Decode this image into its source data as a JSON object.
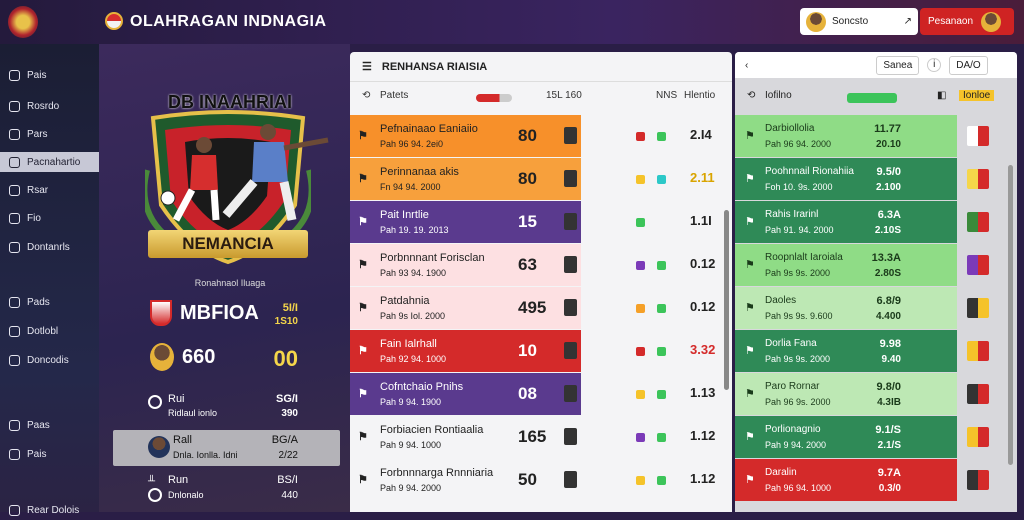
{
  "app": {
    "title": "OLAHRAGAN INDNAGIA",
    "search_text": "Soncsto",
    "cta_label": "Pesanaon"
  },
  "colors": {
    "accent": "#cf2323",
    "gold": "#f5d64a",
    "orange": "#f7902a",
    "purple": "#5a3a8e",
    "red": "#d42a2a",
    "green": "#2f8a57",
    "lightgreen": "#8fdc86"
  },
  "sidebar": {
    "items": [
      {
        "label": "Pais",
        "icon": "ball-icon"
      },
      {
        "label": "Rosrdo",
        "icon": "calendar-icon"
      },
      {
        "label": "Pars",
        "icon": "book-icon"
      },
      {
        "label": "Pacnahartio",
        "icon": "trophy-icon",
        "active": true
      },
      {
        "label": "Rsar",
        "icon": "chat-icon"
      },
      {
        "label": "Fio",
        "icon": "doc-icon"
      },
      {
        "label": "Dontanrls",
        "icon": "home-icon"
      },
      {
        "label": "Pads",
        "icon": "globe-icon"
      },
      {
        "label": "Dotlobl",
        "icon": "list-icon"
      },
      {
        "label": "Doncodis",
        "icon": "shield-icon"
      },
      {
        "label": "Paas",
        "icon": "star-icon"
      },
      {
        "label": "Pais",
        "icon": "users-icon"
      },
      {
        "label": "Rear Dolois",
        "icon": "logout-icon"
      }
    ]
  },
  "hero": {
    "crest_title": "DB INAAHRIAI",
    "banner": "NEMANCIA",
    "subtitle": "Ronahnaol Iluaga",
    "rows": [
      {
        "name": "MBFIOA",
        "val1": "5I/I",
        "val2": "1S10"
      },
      {
        "name": "660",
        "val1": "00",
        "val2": ""
      },
      {
        "name": "Rui",
        "sub": "Ridlaul ionlo",
        "val1": "SG/I",
        "val2": "390"
      }
    ],
    "cards": [
      {
        "name": "Rall",
        "sub": "Dnla. Ionlla. Idni",
        "val1": "BG/A",
        "val2": "2/22"
      },
      {
        "name": "Run",
        "sub": "Dnlonalo",
        "val1": "BS/I",
        "val2": "440"
      }
    ]
  },
  "standings": {
    "title": "RENHANSA RIAISIA",
    "columns": {
      "c1": "Patets",
      "c2": "15L 160",
      "c3": "NNS",
      "c4": "Hlentio"
    },
    "rows": [
      {
        "title": "Pefnainaao Eaniaiio",
        "sub": "Pah 96 94. 2ei0",
        "num": "80",
        "val": "2.I4",
        "bg": "#f7902a",
        "dots": [
          "#d42a2a",
          "#3cc45a"
        ]
      },
      {
        "title": "Perinnanaa akis",
        "sub": "Fn 94 94. 2000",
        "num": "80",
        "val": "2.11",
        "bg": "#f7a03c",
        "dots": [
          "#f5c32a",
          "#2cc8c8"
        ],
        "valColor": "#d9a400"
      },
      {
        "title": "Pait Inrtlie",
        "sub": "Pah 19. 19. 2013",
        "num": "15",
        "val": "1.1I",
        "bg": "#5a3a8e",
        "dots": [
          "#3cc45a"
        ]
      },
      {
        "title": "Porbnnnant Forisclan",
        "sub": "Pah 93 94. 1900",
        "num": "63",
        "val": "0.12",
        "bg": "#fde0e2",
        "dots": [
          "#7b3ab8",
          "#3cc45a"
        ]
      },
      {
        "title": "Patdahnia",
        "sub": "Pah 9s Iol. 2000",
        "num": "495",
        "val": "0.12",
        "bg": "#fde0e2",
        "dots": [
          "#f5a028",
          "#3cc45a"
        ]
      },
      {
        "title": "Fain Ialrhall",
        "sub": "Pah 92 94. 1000",
        "num": "10",
        "val": "3.32",
        "bg": "#d42a2a",
        "dots": [
          "#d42a2a",
          "#3cc45a"
        ],
        "valColor": "#d42a2a"
      },
      {
        "title": "Cofntchaio Pnihs",
        "sub": "Pah 9 94. 1900",
        "num": "08",
        "val": "1.13",
        "bg": "#5a3a8e",
        "dots": [
          "#f5c32a",
          "#3cc45a"
        ]
      },
      {
        "title": "Forbiacien Rontiaalia",
        "sub": "Pah 9 94. 1000",
        "num": "165",
        "val": "1.12",
        "bg": "#f4f4f6",
        "dots": [
          "#7b3ab8",
          "#3cc45a"
        ]
      },
      {
        "title": "Forbnnnarga Rnnniaria",
        "sub": "Pah 9 94. 2000",
        "num": "50",
        "val": "1.12",
        "bg": "#f4f4f6",
        "dots": [
          "#f5c32a",
          "#3cc45a"
        ]
      }
    ]
  },
  "odds": {
    "tab_a": "Sanea",
    "tab_b": "DA/O",
    "header_left": "Iofilno",
    "header_tag": "Ionloe",
    "rows": [
      {
        "title": "Darbiollolia",
        "sub": "Pah 96 94. 2000",
        "v1": "11.77",
        "v2": "20.10",
        "bg": "#8fdc86"
      },
      {
        "title": "Poohnnail Rionahiia",
        "sub": "Foh 10. 9s. 2000",
        "v1": "9.5/0",
        "v2": "2.100",
        "bg": "#2f8a57"
      },
      {
        "title": "Rahis Irarinl",
        "sub": "Pah 91. 94. 2000",
        "v1": "6.3A",
        "v2": "2.10S",
        "bg": "#2f8a57"
      },
      {
        "title": "Roopnlalt Iaroiala",
        "sub": "Pah 9s 9s. 2000",
        "v1": "13.3A",
        "v2": "2.80S",
        "bg": "#8fdc86"
      },
      {
        "title": "Daoles",
        "sub": "Pah 9s 9s. 9.600",
        "v1": "6.8/9",
        "v2": "4.400",
        "bg": "#bde8b4"
      },
      {
        "title": "Dorlia Fana",
        "sub": "Pah 9s 9s. 2000",
        "v1": "9.98",
        "v2": "9.40",
        "bg": "#2f8a57"
      },
      {
        "title": "Paro Rornar",
        "sub": "Pah 96 9s. 2000",
        "v1": "9.8/0",
        "v2": "4.3IB",
        "bg": "#bde8b4"
      },
      {
        "title": "Porlionagnio",
        "sub": "Pah 9 94. 2000",
        "v1": "9.1/S",
        "v2": "2.1/S",
        "bg": "#2f8a57"
      },
      {
        "title": "Daralin",
        "sub": "Pah 96 94. 1000",
        "v1": "9.7A",
        "v2": "0.3/0",
        "bg": "#d42a2a"
      }
    ]
  }
}
